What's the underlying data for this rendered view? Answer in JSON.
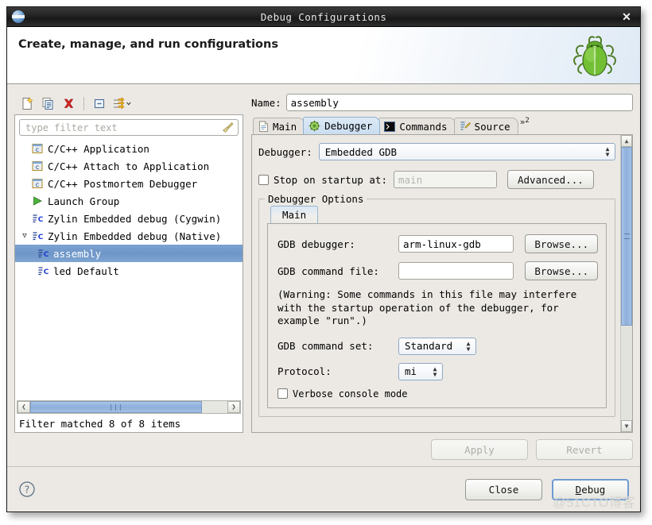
{
  "window": {
    "title": "Debug Configurations",
    "close_label": "✕",
    "app_icon": "eclipse-globe-icon"
  },
  "header": {
    "title": "Create, manage, and run configurations",
    "icon": "green-bug-icon"
  },
  "left_toolbar": {
    "buttons": [
      {
        "name": "new-configuration-icon",
        "title": "New launch configuration"
      },
      {
        "name": "duplicate-configuration-icon",
        "title": "Duplicate"
      },
      {
        "name": "delete-configuration-icon",
        "title": "Delete"
      },
      {
        "name": "collapse-all-icon",
        "title": "Collapse All"
      },
      {
        "name": "filter-icon",
        "title": "Filter launch configurations"
      }
    ]
  },
  "filter": {
    "placeholder": "type filter text",
    "value": "",
    "clear_icon": "broom-icon",
    "status": "Filter matched 8 of 8 items"
  },
  "tree": {
    "items": [
      {
        "label": "C/C++ Application",
        "icon": "c-app-icon",
        "indent": 0,
        "expander": "",
        "selected": false
      },
      {
        "label": "C/C++ Attach to Application",
        "icon": "c-app-icon",
        "indent": 0,
        "expander": "",
        "selected": false
      },
      {
        "label": "C/C++ Postmortem Debugger",
        "icon": "c-app-icon",
        "indent": 0,
        "expander": "",
        "selected": false
      },
      {
        "label": "Launch Group",
        "icon": "launch-group-icon",
        "indent": 0,
        "expander": "",
        "selected": false
      },
      {
        "label": "Zylin Embedded debug (Cygwin)",
        "icon": "zylin-icon",
        "indent": 0,
        "expander": "",
        "selected": false
      },
      {
        "label": "Zylin Embedded debug (Native)",
        "icon": "zylin-icon",
        "indent": 0,
        "expander": "▽",
        "selected": false
      },
      {
        "label": "assembly",
        "icon": "zylin-config-icon",
        "indent": 1,
        "expander": "",
        "selected": true
      },
      {
        "label": "led Default",
        "icon": "zylin-config-icon",
        "indent": 1,
        "expander": "",
        "selected": false
      }
    ]
  },
  "name_field": {
    "label": "Name:",
    "value": "assembly"
  },
  "tabs": [
    {
      "label": "Main",
      "icon": "document-icon",
      "active": false
    },
    {
      "label": "Debugger",
      "icon": "bug-gear-icon",
      "active": true
    },
    {
      "label": "Commands",
      "icon": "terminal-icon",
      "active": false
    },
    {
      "label": "Source",
      "icon": "source-edit-icon",
      "active": false
    }
  ],
  "tab_overflow": {
    "symbol": "»",
    "count": "2"
  },
  "debugger_tab": {
    "debugger_label": "Debugger:",
    "debugger_value": "Embedded GDB",
    "stop_on_startup": {
      "label": "Stop on startup at:",
      "checked": false,
      "value": "",
      "placeholder": "main"
    },
    "advanced_button": "Advanced...",
    "group_title": "Debugger Options",
    "inner_tabs": [
      {
        "label": "Main",
        "active": true
      }
    ],
    "gdb_debugger": {
      "label": "GDB debugger:",
      "value": "arm-linux-gdb",
      "browse": "Browse..."
    },
    "gdb_command_file": {
      "label": "GDB command file:",
      "value": "",
      "browse": "Browse..."
    },
    "warning": "(Warning: Some commands in this file may interfere\nwith the startup operation of the debugger, for\nexample \"run\".)",
    "gdb_command_set": {
      "label": "GDB command set:",
      "value": "Standard"
    },
    "protocol": {
      "label": "Protocol:",
      "value": "mi"
    },
    "verbose_console": {
      "label": "Verbose console mode",
      "checked": false
    }
  },
  "action_buttons": {
    "apply": "Apply",
    "revert": "Revert"
  },
  "footer": {
    "help_icon": "help-question-icon",
    "close": "Close",
    "debug": "Debug"
  },
  "watermark": "@51CTO博客"
}
